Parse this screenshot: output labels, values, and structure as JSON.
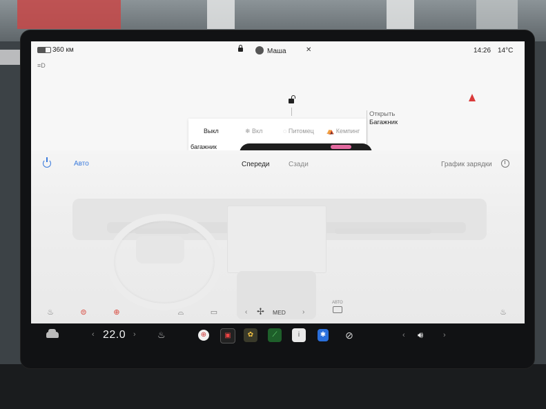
{
  "status_bar": {
    "range": "360 км",
    "user": "Маша",
    "time": "14:26",
    "outside_temp": "14°C",
    "battery_level": 0.6
  },
  "map": {
    "trunk_label_line1": "Открыть",
    "trunk_label_line2": "Багажник"
  },
  "mode_panel": {
    "options": [
      "Выкл",
      "Вкл",
      "Питомец",
      "Кемпинг"
    ],
    "selected": "Выкл",
    "trunk_text": "багажник"
  },
  "climate": {
    "auto_label": "Авто",
    "tab_front": "Спереди",
    "tab_rear": "Сзади",
    "charge_schedule": "График зарядки",
    "fan_label": "MED",
    "recirc_label": "АВТО",
    "icons": {
      "power": "power-icon",
      "seat_heater_left": "seat-heater-icon",
      "rear_defrost": "rear-defrost-icon",
      "steering_heater": "steering-heater-icon",
      "front_defrost": "front-defrost-icon",
      "rear_window": "rear-window-icon",
      "fan": "fan-icon",
      "recirculation": "recirculation-icon",
      "seat_heater_right": "seat-heater-icon",
      "clock": "clock-icon"
    },
    "accent_color": "#3b7bdc",
    "warning_color": "#d9453a"
  },
  "taskbar": {
    "temperature": "22.0",
    "temp_left_arrow": "‹",
    "temp_right_arrow": "›",
    "vol_left_arrow": "‹",
    "vol_right_arrow": "›",
    "apps": [
      "steering-wheel-app",
      "arcade-app",
      "photo-app",
      "energy-app",
      "manual-app",
      "bluetooth-app",
      "off-app"
    ]
  }
}
